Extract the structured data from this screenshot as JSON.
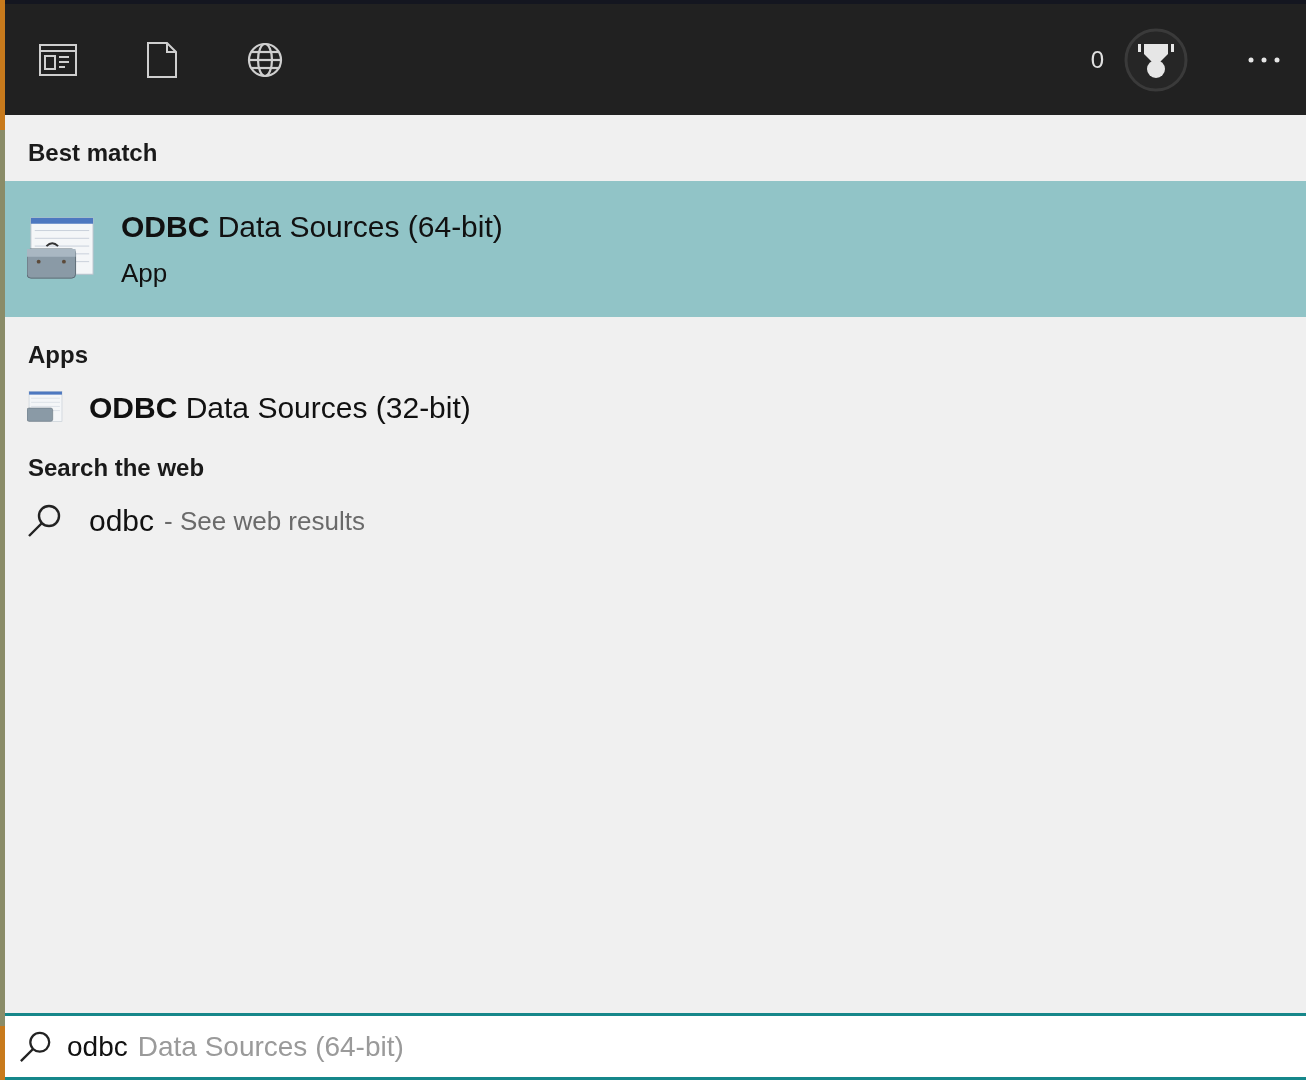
{
  "toolbar": {
    "reward_count": "0"
  },
  "sections": [
    {
      "heading": "Best match",
      "items": [
        {
          "kind": "large-app",
          "title": "**ODBC** Data Sources (64-bit)",
          "subtitle": "App",
          "selected": true
        }
      ]
    },
    {
      "heading": "Apps",
      "items": [
        {
          "kind": "app",
          "title": "**ODBC** Data Sources (32-bit)",
          "selected": false
        }
      ]
    },
    {
      "heading": "Search the web",
      "items": [
        {
          "kind": "web",
          "query": "odbc",
          "suffix": "- See web results",
          "selected": false
        }
      ]
    }
  ],
  "search_box": {
    "value": "odbc",
    "suggestion": "Data Sources (64-bit)"
  }
}
